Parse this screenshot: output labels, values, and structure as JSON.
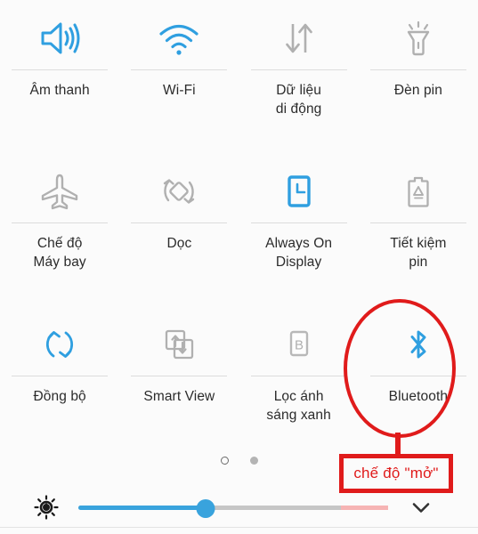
{
  "screen": {
    "name": "android-quick-settings-panel",
    "background_color": "#fbfbfb",
    "active_color": "#2f9fe0",
    "inactive_color": "#b0b0b0",
    "annotation_color": "#e01b1b"
  },
  "tiles": [
    {
      "label": "Âm thanh",
      "icon": "sound-icon",
      "state": "on",
      "color": "#2f9fe0"
    },
    {
      "label": "Wi-Fi",
      "icon": "wifi-icon",
      "state": "on",
      "color": "#2f9fe0"
    },
    {
      "label": "Dữ liệu\ndi động",
      "icon": "mobile-data-icon",
      "state": "off",
      "color": "#b0b0b0"
    },
    {
      "label": "Đèn pin",
      "icon": "flashlight-icon",
      "state": "off",
      "color": "#b0b0b0"
    },
    {
      "label": "Chế độ\nMáy bay",
      "icon": "airplane-mode-icon",
      "state": "off",
      "color": "#b0b0b0"
    },
    {
      "label": "Dọc",
      "icon": "auto-rotate-icon",
      "state": "off",
      "color": "#b0b0b0"
    },
    {
      "label": "Always On\nDisplay",
      "icon": "always-on-display-icon",
      "state": "on",
      "color": "#2f9fe0"
    },
    {
      "label": "Tiết kiệm\npin",
      "icon": "battery-saver-icon",
      "state": "off",
      "color": "#b0b0b0"
    },
    {
      "label": "Đồng bộ",
      "icon": "sync-icon",
      "state": "on",
      "color": "#2f9fe0"
    },
    {
      "label": "Smart View",
      "icon": "smart-view-icon",
      "state": "off",
      "color": "#b0b0b0"
    },
    {
      "label": "Lọc ánh\nsáng xanh",
      "icon": "blue-light-filter-icon",
      "state": "off",
      "color": "#b0b0b0"
    },
    {
      "label": "Bluetooth",
      "icon": "bluetooth-icon",
      "state": "on",
      "color": "#2f9fe0"
    }
  ],
  "pager": {
    "pages": 2,
    "current_page": 1,
    "dots": [
      {
        "name": "page-dot-1",
        "style": "hollow"
      },
      {
        "name": "page-dot-2",
        "style": "filled"
      }
    ]
  },
  "brightness": {
    "icon": "brightness-icon",
    "value_percent": 41,
    "expand_icon": "chevron-down-icon"
  },
  "annotation": {
    "highlight_target": "Bluetooth",
    "callout_text": "chế độ \"mở\"",
    "shape": "ellipse",
    "color": "#e01b1b"
  }
}
